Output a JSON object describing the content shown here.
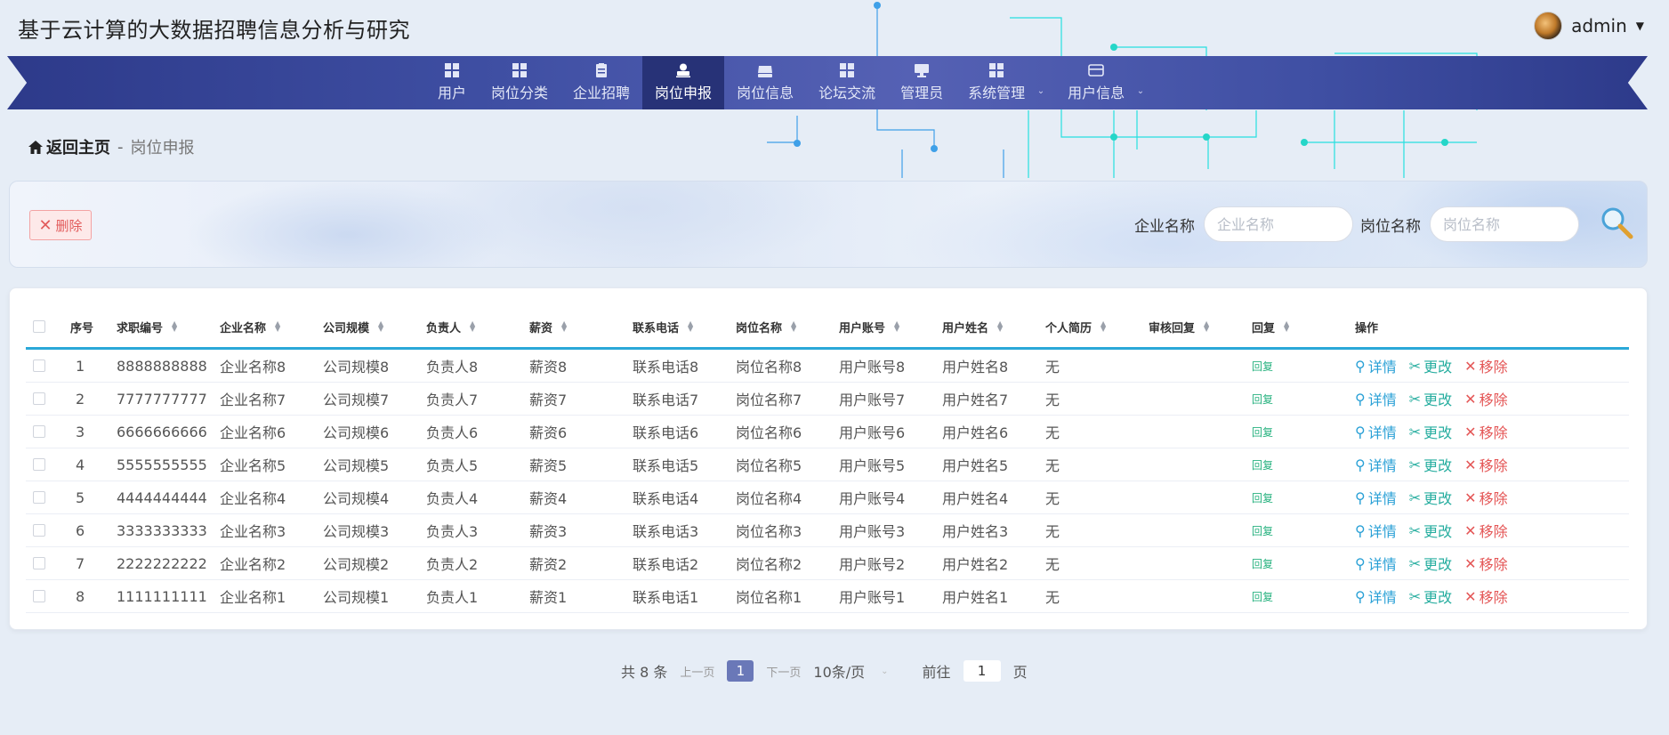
{
  "header": {
    "title": "基于云计算的大数据招聘信息分析与研究",
    "username": "admin"
  },
  "nav": {
    "items": [
      {
        "label": "用户",
        "icon": "grid-icon"
      },
      {
        "label": "岗位分类",
        "icon": "grid-icon"
      },
      {
        "label": "企业招聘",
        "icon": "clipboard-icon"
      },
      {
        "label": "岗位申报",
        "icon": "user-stamp-icon",
        "active": true
      },
      {
        "label": "岗位信息",
        "icon": "inbox-icon"
      },
      {
        "label": "论坛交流",
        "icon": "grid-icon"
      },
      {
        "label": "管理员",
        "icon": "monitor-icon"
      },
      {
        "label": "系统管理",
        "icon": "grid-icon",
        "submenu": true
      },
      {
        "label": "用户信息",
        "icon": "card-icon",
        "submenu": true
      }
    ]
  },
  "breadcrumb": {
    "home": "返回主页",
    "separator": "-",
    "current": "岗位申报"
  },
  "toolbar": {
    "delete_label": "删除",
    "company_label": "企业名称",
    "company_placeholder": "企业名称",
    "position_label": "岗位名称",
    "position_placeholder": "岗位名称"
  },
  "table": {
    "headers": [
      "序号",
      "求职编号",
      "企业名称",
      "公司规模",
      "负责人",
      "薪资",
      "联系电话",
      "岗位名称",
      "用户账号",
      "用户姓名",
      "个人简历",
      "审核回复",
      "回复",
      "操作"
    ],
    "reply_label": "回复",
    "ops": {
      "detail": "详情",
      "edit": "更改",
      "remove": "移除"
    },
    "rows": [
      {
        "idx": "1",
        "num": "8888888888",
        "company": "企业名称8",
        "scale": "公司规模8",
        "owner": "负责人8",
        "salary": "薪资8",
        "phone": "联系电话8",
        "position": "岗位名称8",
        "account": "用户账号8",
        "name": "用户姓名8",
        "resume": "无",
        "audit": ""
      },
      {
        "idx": "2",
        "num": "7777777777",
        "company": "企业名称7",
        "scale": "公司规模7",
        "owner": "负责人7",
        "salary": "薪资7",
        "phone": "联系电话7",
        "position": "岗位名称7",
        "account": "用户账号7",
        "name": "用户姓名7",
        "resume": "无",
        "audit": ""
      },
      {
        "idx": "3",
        "num": "6666666666",
        "company": "企业名称6",
        "scale": "公司规模6",
        "owner": "负责人6",
        "salary": "薪资6",
        "phone": "联系电话6",
        "position": "岗位名称6",
        "account": "用户账号6",
        "name": "用户姓名6",
        "resume": "无",
        "audit": ""
      },
      {
        "idx": "4",
        "num": "5555555555",
        "company": "企业名称5",
        "scale": "公司规模5",
        "owner": "负责人5",
        "salary": "薪资5",
        "phone": "联系电话5",
        "position": "岗位名称5",
        "account": "用户账号5",
        "name": "用户姓名5",
        "resume": "无",
        "audit": ""
      },
      {
        "idx": "5",
        "num": "4444444444",
        "company": "企业名称4",
        "scale": "公司规模4",
        "owner": "负责人4",
        "salary": "薪资4",
        "phone": "联系电话4",
        "position": "岗位名称4",
        "account": "用户账号4",
        "name": "用户姓名4",
        "resume": "无",
        "audit": ""
      },
      {
        "idx": "6",
        "num": "3333333333",
        "company": "企业名称3",
        "scale": "公司规模3",
        "owner": "负责人3",
        "salary": "薪资3",
        "phone": "联系电话3",
        "position": "岗位名称3",
        "account": "用户账号3",
        "name": "用户姓名3",
        "resume": "无",
        "audit": ""
      },
      {
        "idx": "7",
        "num": "2222222222",
        "company": "企业名称2",
        "scale": "公司规模2",
        "owner": "负责人2",
        "salary": "薪资2",
        "phone": "联系电话2",
        "position": "岗位名称2",
        "account": "用户账号2",
        "name": "用户姓名2",
        "resume": "无",
        "audit": ""
      },
      {
        "idx": "8",
        "num": "1111111111",
        "company": "企业名称1",
        "scale": "公司规模1",
        "owner": "负责人1",
        "salary": "薪资1",
        "phone": "联系电话1",
        "position": "岗位名称1",
        "account": "用户账号1",
        "name": "用户姓名1",
        "resume": "无",
        "audit": ""
      }
    ]
  },
  "pagination": {
    "total": "共 8 条",
    "prev": "上一页",
    "current_page": "1",
    "next": "下一页",
    "page_size": "10条/页",
    "goto_label": "前往",
    "goto_value": "1",
    "page_unit": "页"
  },
  "colors": {
    "nav_active": "#273277",
    "accent": "#2aa8d8",
    "delete": "#e25b5b",
    "detail": "#29a0d6",
    "edit": "#26ad9f",
    "remove": "#e45656",
    "reply": "#27b27f"
  }
}
